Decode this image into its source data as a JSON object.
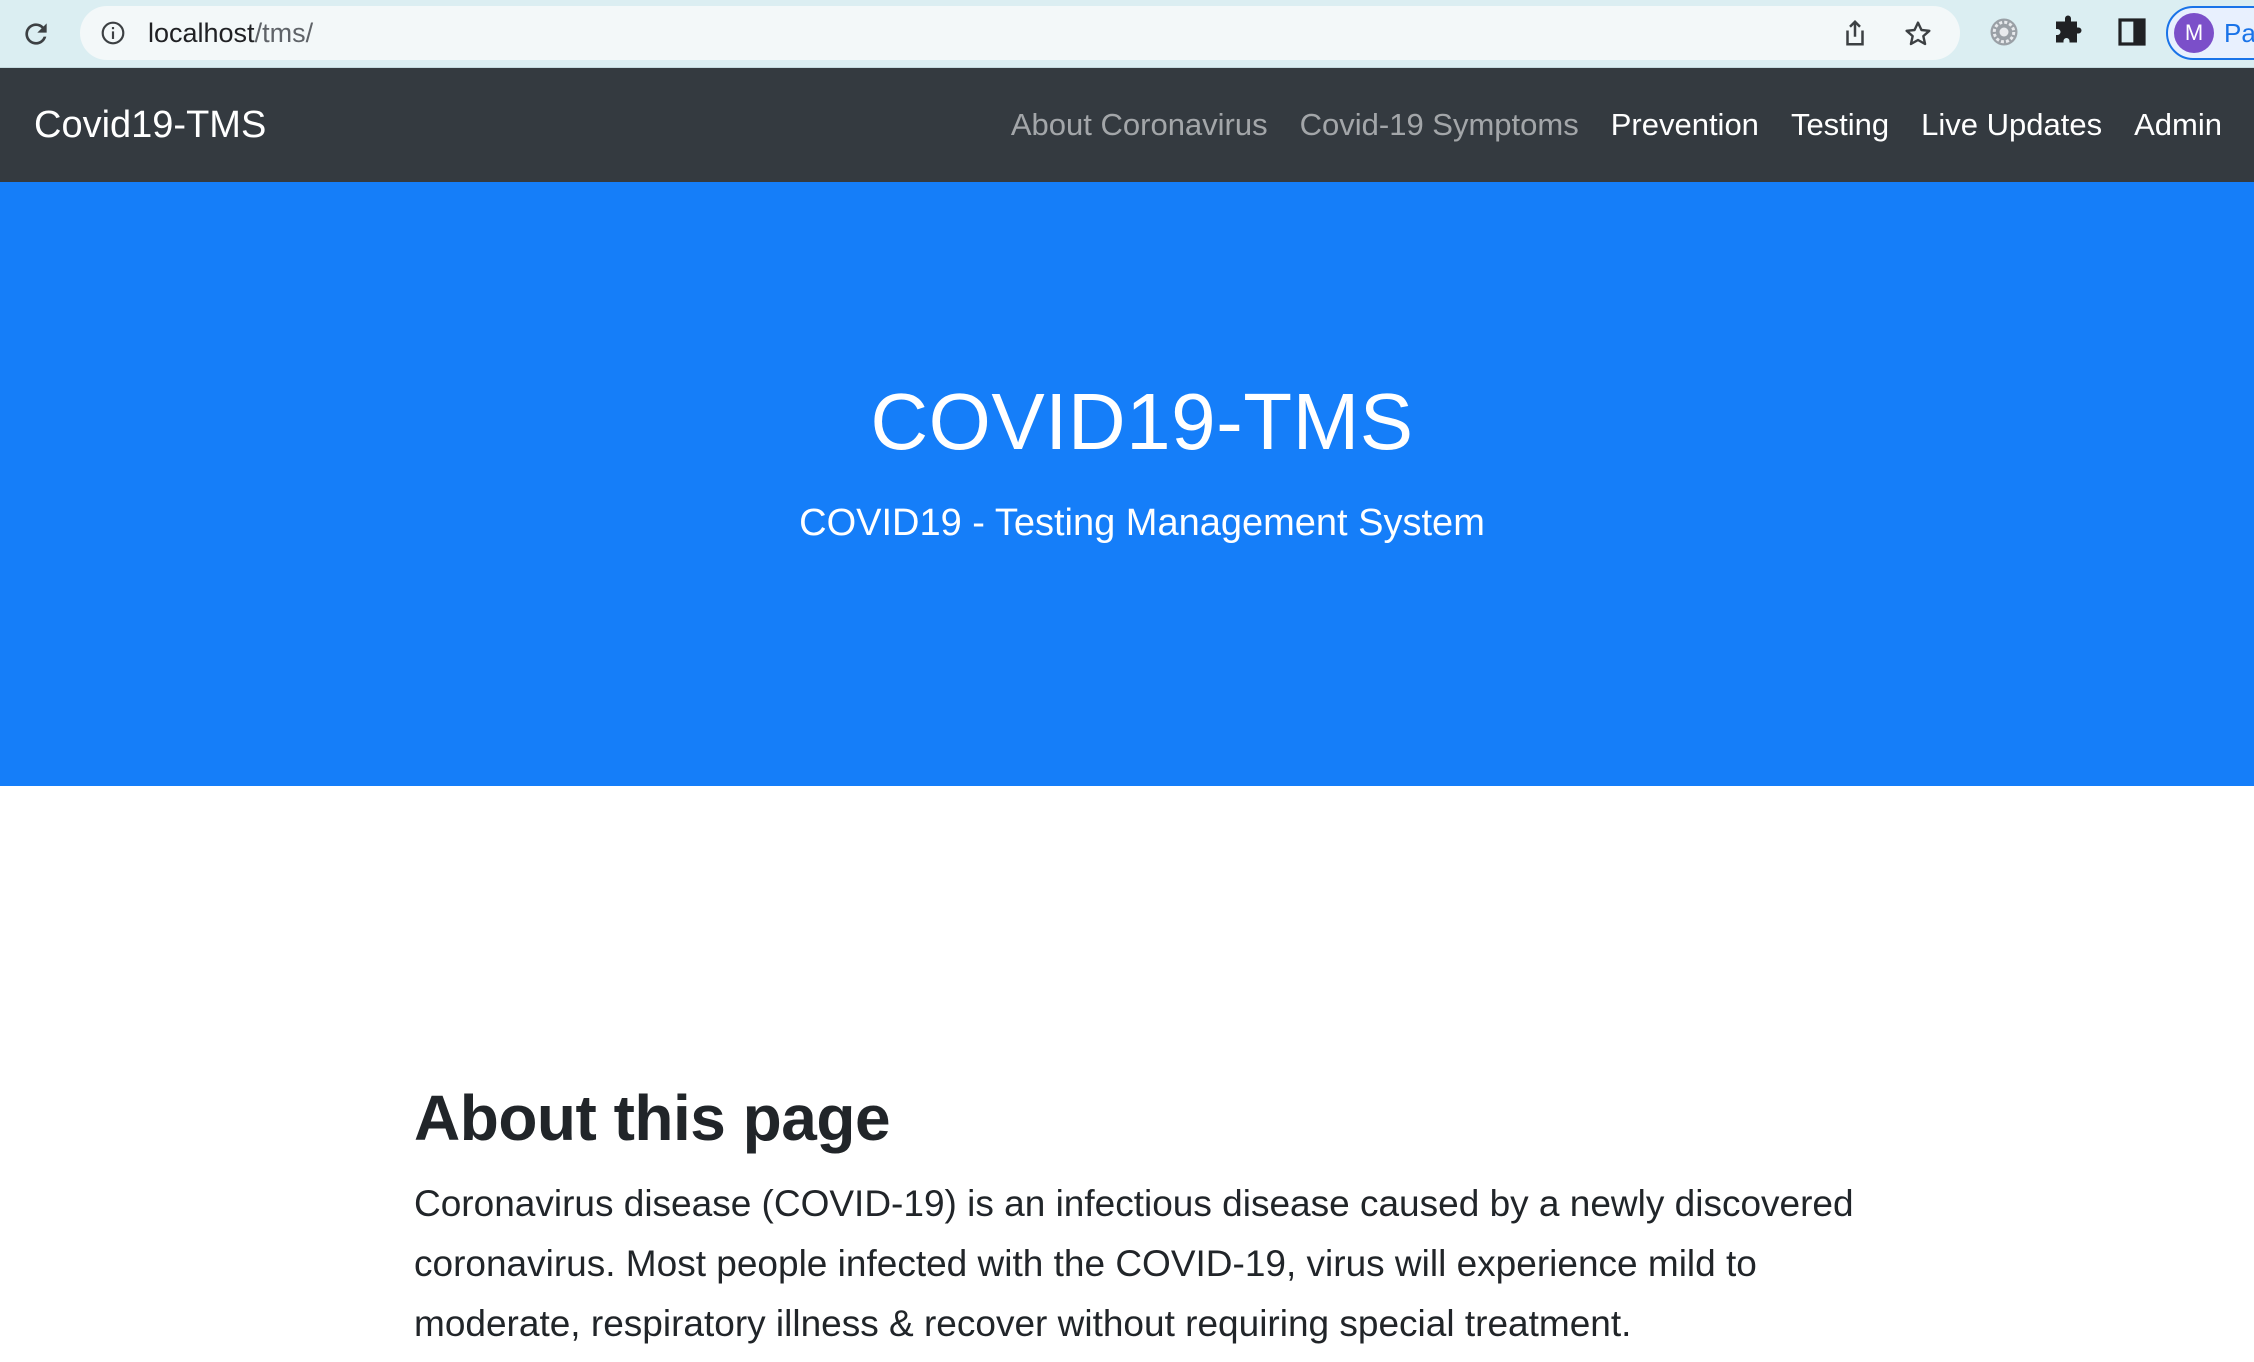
{
  "browser": {
    "url_host": "localhost",
    "url_path": "/tms/",
    "profile_initial": "M",
    "profile_chip_text": "Pa",
    "icons": [
      "reload-icon",
      "info-icon",
      "share-icon",
      "star-icon",
      "gear-extension-icon",
      "puzzle-icon",
      "side-panel-icon"
    ]
  },
  "navbar": {
    "brand": "Covid19-TMS",
    "links": [
      {
        "label": "About Coronavirus",
        "state": "dim"
      },
      {
        "label": "Covid-19 Symptoms",
        "state": "dim"
      },
      {
        "label": "Prevention",
        "state": "bright"
      },
      {
        "label": "Testing",
        "state": "bright"
      },
      {
        "label": "Live Updates",
        "state": "bright"
      },
      {
        "label": "Admin",
        "state": "bright"
      }
    ]
  },
  "hero": {
    "title": "COVID19-TMS",
    "subtitle": "COVID19 - Testing Management System"
  },
  "about": {
    "heading": "About this page",
    "body": "Coronavirus disease (COVID-19) is an infectious disease caused by a newly discovered coronavirus. Most people infected with the COVID-19, virus will experience mild to moderate, respiratory illness & recover without requiring special treatment."
  },
  "colors": {
    "navbar_bg": "#343a40",
    "hero_bg": "#157ef9",
    "chrome_bg": "#dbeef2",
    "avatar_bg": "#7b4fc9"
  }
}
